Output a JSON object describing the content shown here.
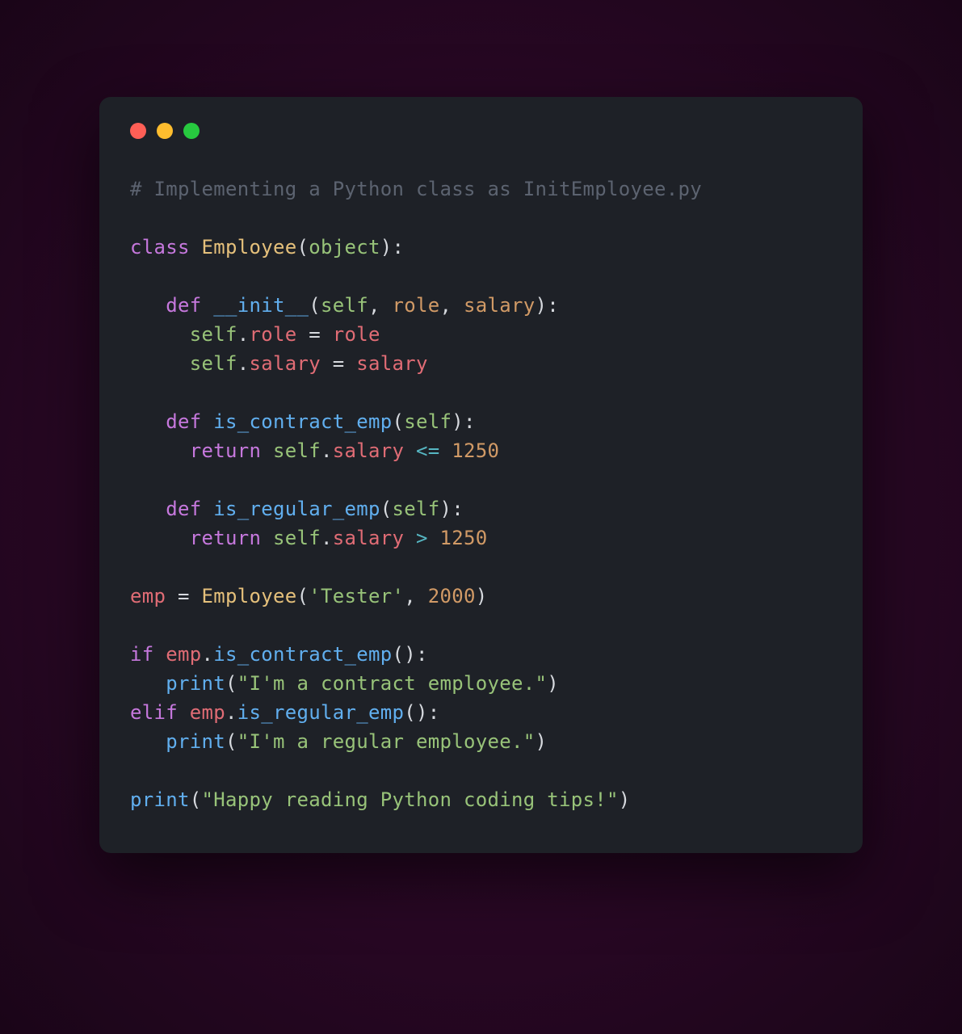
{
  "colors": {
    "bg": "#1e2127",
    "dot_red": "#ff5f56",
    "dot_yellow": "#ffbd2e",
    "dot_green": "#27c93f",
    "comment": "#5c6370",
    "keyword": "#c678dd",
    "classname": "#e5c07b",
    "builtin": "#98c379",
    "funcname": "#61afef",
    "self": "#98c379",
    "param": "#d19a66",
    "prop": "#e06c75",
    "op": "#56b6c2",
    "num": "#d19a66",
    "str": "#98c379"
  },
  "code": {
    "language": "python",
    "lines": [
      {
        "tokens": [
          {
            "t": "# Implementing a Python class as InitEmployee.py",
            "c": "comment"
          }
        ]
      },
      {
        "tokens": [
          {
            "t": "",
            "c": ""
          }
        ]
      },
      {
        "tokens": [
          {
            "t": "class ",
            "c": "keyword"
          },
          {
            "t": "Employee",
            "c": "classname"
          },
          {
            "t": "(",
            "c": "paren"
          },
          {
            "t": "object",
            "c": "builtin"
          },
          {
            "t": "):",
            "c": "paren"
          }
        ]
      },
      {
        "tokens": [
          {
            "t": "",
            "c": ""
          }
        ]
      },
      {
        "tokens": [
          {
            "t": "   ",
            "c": ""
          },
          {
            "t": "def ",
            "c": "keyword"
          },
          {
            "t": "__init__",
            "c": "funcname"
          },
          {
            "t": "(",
            "c": "paren"
          },
          {
            "t": "self",
            "c": "self"
          },
          {
            "t": ", ",
            "c": "paren"
          },
          {
            "t": "role",
            "c": "param"
          },
          {
            "t": ", ",
            "c": "paren"
          },
          {
            "t": "salary",
            "c": "param"
          },
          {
            "t": "):",
            "c": "paren"
          }
        ]
      },
      {
        "tokens": [
          {
            "t": "     ",
            "c": ""
          },
          {
            "t": "self",
            "c": "self"
          },
          {
            "t": ".",
            "c": "paren"
          },
          {
            "t": "role",
            "c": "prop"
          },
          {
            "t": " = ",
            "c": "assign"
          },
          {
            "t": "role",
            "c": "ident"
          }
        ]
      },
      {
        "tokens": [
          {
            "t": "     ",
            "c": ""
          },
          {
            "t": "self",
            "c": "self"
          },
          {
            "t": ".",
            "c": "paren"
          },
          {
            "t": "salary",
            "c": "prop"
          },
          {
            "t": " = ",
            "c": "assign"
          },
          {
            "t": "salary",
            "c": "ident"
          }
        ]
      },
      {
        "tokens": [
          {
            "t": "",
            "c": ""
          }
        ]
      },
      {
        "tokens": [
          {
            "t": "   ",
            "c": ""
          },
          {
            "t": "def ",
            "c": "keyword"
          },
          {
            "t": "is_contract_emp",
            "c": "funcname"
          },
          {
            "t": "(",
            "c": "paren"
          },
          {
            "t": "self",
            "c": "self"
          },
          {
            "t": "):",
            "c": "paren"
          }
        ]
      },
      {
        "tokens": [
          {
            "t": "     ",
            "c": ""
          },
          {
            "t": "return ",
            "c": "keyword"
          },
          {
            "t": "self",
            "c": "self"
          },
          {
            "t": ".",
            "c": "paren"
          },
          {
            "t": "salary",
            "c": "prop"
          },
          {
            "t": " <= ",
            "c": "op"
          },
          {
            "t": "1250",
            "c": "num"
          }
        ]
      },
      {
        "tokens": [
          {
            "t": "",
            "c": ""
          }
        ]
      },
      {
        "tokens": [
          {
            "t": "   ",
            "c": ""
          },
          {
            "t": "def ",
            "c": "keyword"
          },
          {
            "t": "is_regular_emp",
            "c": "funcname"
          },
          {
            "t": "(",
            "c": "paren"
          },
          {
            "t": "self",
            "c": "self"
          },
          {
            "t": "):",
            "c": "paren"
          }
        ]
      },
      {
        "tokens": [
          {
            "t": "     ",
            "c": ""
          },
          {
            "t": "return ",
            "c": "keyword"
          },
          {
            "t": "self",
            "c": "self"
          },
          {
            "t": ".",
            "c": "paren"
          },
          {
            "t": "salary",
            "c": "prop"
          },
          {
            "t": " > ",
            "c": "op"
          },
          {
            "t": "1250",
            "c": "num"
          }
        ]
      },
      {
        "tokens": [
          {
            "t": "",
            "c": ""
          }
        ]
      },
      {
        "tokens": [
          {
            "t": "emp",
            "c": "varname"
          },
          {
            "t": " = ",
            "c": "assign"
          },
          {
            "t": "Employee",
            "c": "classname"
          },
          {
            "t": "(",
            "c": "paren"
          },
          {
            "t": "'Tester'",
            "c": "str"
          },
          {
            "t": ", ",
            "c": "paren"
          },
          {
            "t": "2000",
            "c": "num"
          },
          {
            "t": ")",
            "c": "paren"
          }
        ]
      },
      {
        "tokens": [
          {
            "t": "",
            "c": ""
          }
        ]
      },
      {
        "tokens": [
          {
            "t": "if ",
            "c": "keyword"
          },
          {
            "t": "emp",
            "c": "varname"
          },
          {
            "t": ".",
            "c": "paren"
          },
          {
            "t": "is_contract_emp",
            "c": "funcname"
          },
          {
            "t": "():",
            "c": "paren"
          }
        ]
      },
      {
        "tokens": [
          {
            "t": "   ",
            "c": ""
          },
          {
            "t": "print",
            "c": "pcall"
          },
          {
            "t": "(",
            "c": "paren"
          },
          {
            "t": "\"I'm a contract employee.\"",
            "c": "str"
          },
          {
            "t": ")",
            "c": "paren"
          }
        ]
      },
      {
        "tokens": [
          {
            "t": "elif ",
            "c": "keyword"
          },
          {
            "t": "emp",
            "c": "varname"
          },
          {
            "t": ".",
            "c": "paren"
          },
          {
            "t": "is_regular_emp",
            "c": "funcname"
          },
          {
            "t": "():",
            "c": "paren"
          }
        ]
      },
      {
        "tokens": [
          {
            "t": "   ",
            "c": ""
          },
          {
            "t": "print",
            "c": "pcall"
          },
          {
            "t": "(",
            "c": "paren"
          },
          {
            "t": "\"I'm a regular employee.\"",
            "c": "str"
          },
          {
            "t": ")",
            "c": "paren"
          }
        ]
      },
      {
        "tokens": [
          {
            "t": "",
            "c": ""
          }
        ]
      },
      {
        "tokens": [
          {
            "t": "print",
            "c": "pcall"
          },
          {
            "t": "(",
            "c": "paren"
          },
          {
            "t": "\"Happy reading Python coding tips!\"",
            "c": "str"
          },
          {
            "t": ")",
            "c": "paren"
          }
        ]
      }
    ]
  }
}
